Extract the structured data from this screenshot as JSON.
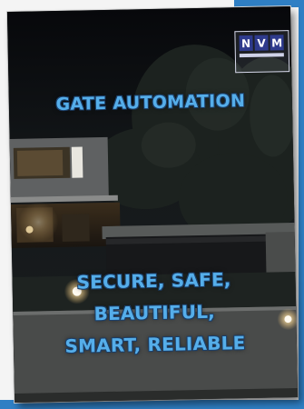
{
  "brochure": {
    "logo": {
      "letters": [
        "N",
        "V",
        "M"
      ]
    },
    "title": "GATE AUTOMATION",
    "tagline": [
      "SECURE, SAFE,",
      "BEAUTIFUL,",
      "SMART, RELIABLE"
    ]
  },
  "colors": {
    "heading": "#55aeea",
    "logo_block": "#2e3a8c",
    "page_edge": "#2f7fc4"
  }
}
